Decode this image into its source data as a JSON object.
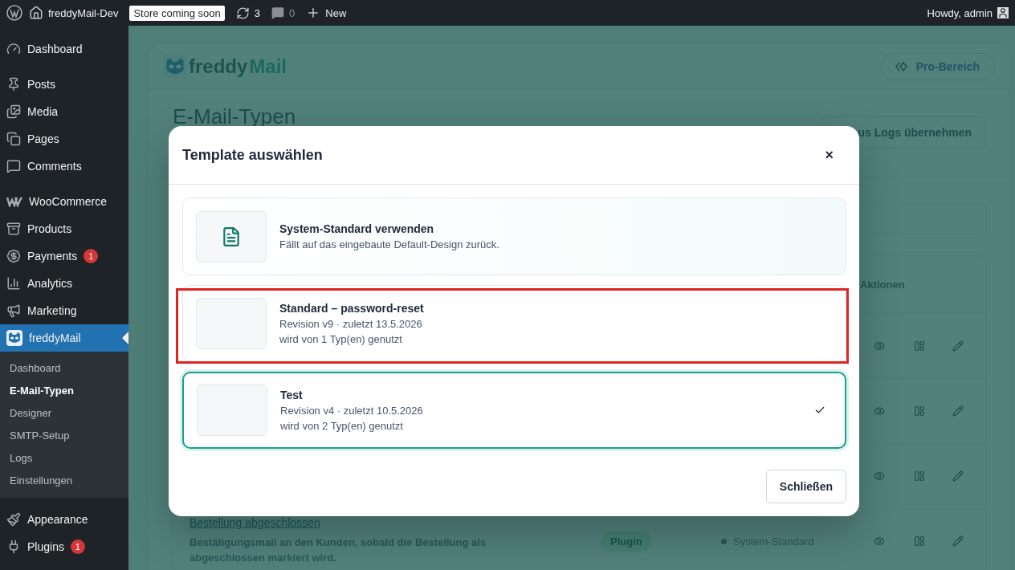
{
  "admin_bar": {
    "site_name": "freddyMail-Dev",
    "store_badge": "Store coming soon",
    "updates": "3",
    "comments": "0",
    "new": "New",
    "greeting": "Howdy, admin"
  },
  "sidebar": {
    "groups": [
      [
        {
          "label": "Dashboard",
          "selected": false
        }
      ],
      [
        {
          "label": "Posts",
          "selected": false
        },
        {
          "label": "Media",
          "selected": false
        },
        {
          "label": "Pages",
          "selected": false
        },
        {
          "label": "Comments",
          "selected": false
        }
      ],
      [
        {
          "label": "WooCommerce",
          "selected": false
        },
        {
          "label": "Products",
          "selected": false
        },
        {
          "label": "Payments",
          "selected": false,
          "badge": "1"
        },
        {
          "label": "Analytics",
          "selected": false
        },
        {
          "label": "Marketing",
          "selected": false
        },
        {
          "label": "freddyMail",
          "selected": true,
          "children": [
            {
              "label": "Dashboard",
              "selected": false
            },
            {
              "label": "E-Mail-Typen",
              "selected": true
            },
            {
              "label": "Designer",
              "selected": false
            },
            {
              "label": "SMTP-Setup",
              "selected": false
            },
            {
              "label": "Logs",
              "selected": false
            },
            {
              "label": "Einstellungen",
              "selected": false
            }
          ]
        }
      ],
      [
        {
          "label": "Appearance",
          "selected": false
        },
        {
          "label": "Plugins",
          "selected": false,
          "badge": "1"
        }
      ]
    ]
  },
  "page": {
    "logo": [
      "freddy",
      "Mail"
    ],
    "pro_button": "Pro-Bereich",
    "heading": "E-Mail-Typen",
    "header_button": "us Logs übernehmen",
    "table": {
      "column_header": "Aktionen",
      "rows": [
        {
          "kind": "covered"
        },
        {
          "kind": "covered"
        },
        {
          "kind": "covered"
        },
        {
          "kind": "full",
          "name": "Bestellung abgeschlossen",
          "description": "Bestätigungsmail an den Kunden, sobald die Bestellung als abgeschlossen markiert wird.",
          "source": "Plugin",
          "template": "System-Standard"
        }
      ]
    }
  },
  "modal": {
    "title": "Template auswählen",
    "close": "×",
    "options": [
      {
        "kind": "system",
        "title": "System-Standard verwenden",
        "lines": [
          "Fällt auf das eingebaute Default-Design zurück."
        ],
        "selected": false,
        "highlighted": false
      },
      {
        "kind": "template",
        "title": "Standard – password-reset",
        "lines": [
          "Revision v9 · zuletzt 13.5.2026",
          "wird von 1 Typ(en) genutzt"
        ],
        "selected": false,
        "highlighted": true
      },
      {
        "kind": "template",
        "title": "Test",
        "lines": [
          "Revision v4 · zuletzt 10.5.2026",
          "wird von 2 Typ(en) genutzt"
        ],
        "selected": true,
        "highlighted": false
      }
    ],
    "footer_button": "Schließen"
  }
}
